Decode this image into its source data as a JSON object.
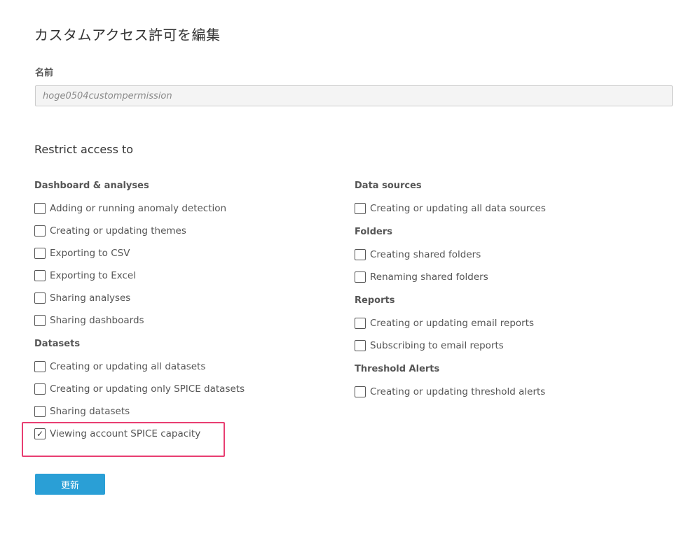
{
  "page": {
    "title": "カスタムアクセス許可を編集"
  },
  "name_field": {
    "label": "名前",
    "value": "hoge0504custompermission"
  },
  "restrict": {
    "title": "Restrict access to"
  },
  "left_groups": [
    {
      "title": "Dashboard & analyses",
      "items": [
        {
          "label": "Adding or running anomaly detection",
          "checked": false
        },
        {
          "label": "Creating or updating themes",
          "checked": false
        },
        {
          "label": "Exporting to CSV",
          "checked": false
        },
        {
          "label": "Exporting to Excel",
          "checked": false
        },
        {
          "label": "Sharing analyses",
          "checked": false
        },
        {
          "label": "Sharing dashboards",
          "checked": false
        }
      ]
    },
    {
      "title": "Datasets",
      "items": [
        {
          "label": "Creating or updating all datasets",
          "checked": false
        },
        {
          "label": "Creating or updating only SPICE datasets",
          "checked": false
        },
        {
          "label": "Sharing datasets",
          "checked": false
        },
        {
          "label": "Viewing account SPICE capacity",
          "checked": true
        }
      ]
    }
  ],
  "right_groups": [
    {
      "title": "Data sources",
      "items": [
        {
          "label": "Creating or updating all data sources",
          "checked": false
        }
      ]
    },
    {
      "title": "Folders",
      "items": [
        {
          "label": "Creating shared folders",
          "checked": false
        },
        {
          "label": "Renaming shared folders",
          "checked": false
        }
      ]
    },
    {
      "title": "Reports",
      "items": [
        {
          "label": "Creating or updating email reports",
          "checked": false
        },
        {
          "label": "Subscribing to email reports",
          "checked": false
        }
      ]
    },
    {
      "title": "Threshold Alerts",
      "items": [
        {
          "label": "Creating or updating threshold alerts",
          "checked": false
        }
      ]
    }
  ],
  "highlight_color": "#e83e72",
  "checkmark_glyph": "✓",
  "update_button": {
    "label": "更新",
    "color": "#2a9fd6"
  }
}
